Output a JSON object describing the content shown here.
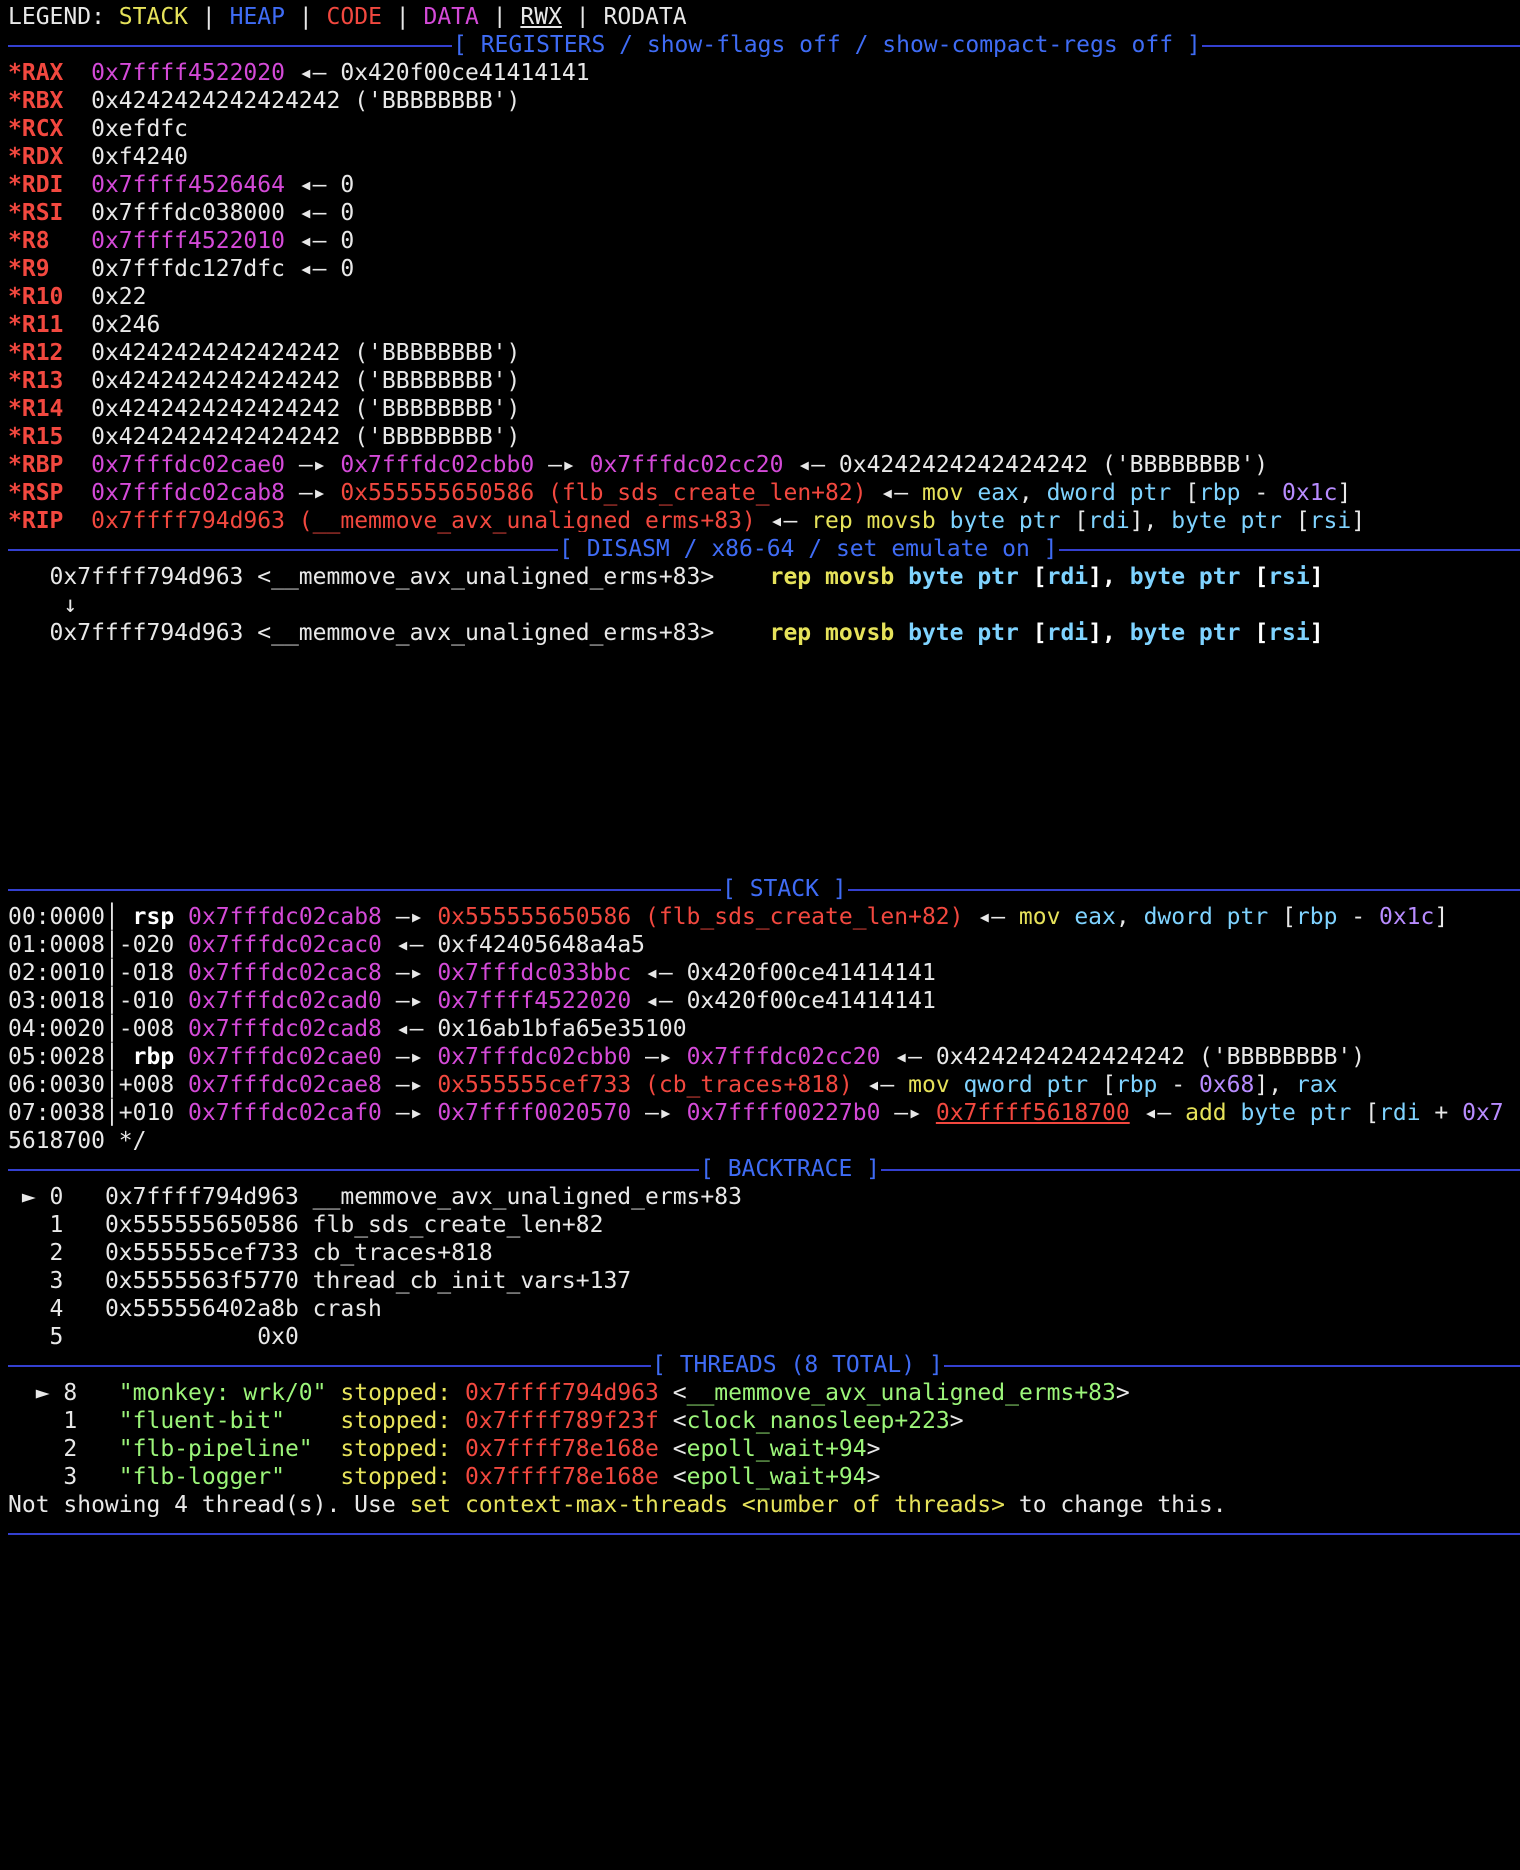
{
  "legend": {
    "label": "LEGEND:",
    "stack": "STACK",
    "heap": "HEAP",
    "code": "CODE",
    "data": "DATA",
    "rwx": "RWX",
    "rodata": "RODATA"
  },
  "headers": {
    "registers": "[ REGISTERS / show-flags off / show-compact-regs off ]",
    "disasm": "[ DISASM / x86-64 / set emulate on ]",
    "stack": "[ STACK ]",
    "backtrace": "[ BACKTRACE ]",
    "threads": "[ THREADS (8 TOTAL) ]"
  },
  "registers": {
    "rax": {
      "name": "*RAX",
      "ptr": "0x7ffff4522020",
      "rest": " ◂— 0x420f00ce41414141"
    },
    "rbx": {
      "name": "*RBX",
      "val": "0x4242424242424242 ('BBBBBBBB')"
    },
    "rcx": {
      "name": "*RCX",
      "val": "0xefdfc"
    },
    "rdx": {
      "name": "*RDX",
      "val": "0xf4240"
    },
    "rdi": {
      "name": "*RDI",
      "ptr": "0x7ffff4526464",
      "rest": " ◂— 0"
    },
    "rsi": {
      "name": "*RSI",
      "ptr": "0x7fffdc038000",
      "rest": " ◂— 0"
    },
    "r8": {
      "name": "*R8",
      "ptr": "0x7ffff4522010",
      "rest": " ◂— 0"
    },
    "r9": {
      "name": "*R9",
      "ptr": "0x7fffdc127dfc",
      "rest": " ◂— 0"
    },
    "r10": {
      "name": "*R10",
      "val": "0x22"
    },
    "r11": {
      "name": "*R11",
      "val": "0x246"
    },
    "r12": {
      "name": "*R12",
      "val": "0x4242424242424242 ('BBBBBBBB')"
    },
    "r13": {
      "name": "*R13",
      "val": "0x4242424242424242 ('BBBBBBBB')"
    },
    "r14": {
      "name": "*R14",
      "val": "0x4242424242424242 ('BBBBBBBB')"
    },
    "r15": {
      "name": "*R15",
      "val": "0x4242424242424242 ('BBBBBBBB')"
    },
    "rbp": {
      "name": "*RBP",
      "p1": "0x7fffdc02cae0",
      "p2": "0x7fffdc02cbb0",
      "p3": "0x7fffdc02cc20",
      "rest": "0x4242424242424242 ('BBBBBBBB')"
    },
    "rsp": {
      "name": "*RSP",
      "p1": "0x7fffdc02cab8",
      "p2": "0x555555650586 (flb_sds_create_len+82)"
    },
    "rip": {
      "name": "*RIP",
      "p1": "0x7ffff794d963 (__memmove_avx_unaligned_erms+83)"
    }
  },
  "disasm": {
    "addr1": "0x7ffff794d963 <__memmove_avx_unaligned_erms+83>",
    "arrow": "↓",
    "addr2": "0x7ffff794d963 <__memmove_avx_unaligned_erms+83>"
  },
  "stack": [
    {
      "idx": "00:0000",
      "off": " rsp",
      "addr": "0x7fffdc02cab8"
    },
    {
      "idx": "01:0008",
      "off": "-020",
      "addr": "0x7fffdc02cac0",
      "rest": "0xf42405648a4a5"
    },
    {
      "idx": "02:0010",
      "off": "-018",
      "addr": "0x7fffdc02cac8",
      "p2": "0x7fffdc033bbc",
      "rest": "0x420f00ce41414141"
    },
    {
      "idx": "03:0018",
      "off": "-010",
      "addr": "0x7fffdc02cad0",
      "p2": "0x7ffff4522020",
      "rest": "0x420f00ce41414141"
    },
    {
      "idx": "04:0020",
      "off": "-008",
      "addr": "0x7fffdc02cad8",
      "rest": "0x16ab1bfa65e35100"
    },
    {
      "idx": "05:0028",
      "off": " rbp",
      "addr": "0x7fffdc02cae0",
      "p2": "0x7fffdc02cbb0",
      "p3": "0x7fffdc02cc20",
      "rest": "0x4242424242424242 ('BBBBBBBB')"
    },
    {
      "idx": "06:0030",
      "off": "+008",
      "addr": "0x7fffdc02cae8",
      "p2": "0x555555cef733 (cb_traces+818)"
    },
    {
      "idx": "07:0038",
      "off": "+010",
      "addr": "0x7fffdc02caf0",
      "p2": "0x7ffff0020570",
      "p3": "0x7ffff00227b0",
      "p4": "0x7ffff5618700"
    }
  ],
  "stack_wrap": "5618700 */",
  "backtrace": [
    {
      "mark": " ► 0",
      "addr": "0x7ffff794d963",
      "sym": "__memmove_avx_unaligned_erms+83"
    },
    {
      "mark": "   1",
      "addr": "0x555555650586",
      "sym": "flb_sds_create_len+82"
    },
    {
      "mark": "   2",
      "addr": "0x555555cef733",
      "sym": "cb_traces+818"
    },
    {
      "mark": "   3",
      "addr": "0x5555563f5770",
      "sym": "thread_cb_init_vars+137"
    },
    {
      "mark": "   4",
      "addr": "0x555556402a8b",
      "sym": "crash"
    },
    {
      "mark": "   5",
      "addr": "           0x0",
      "sym": ""
    }
  ],
  "threads": [
    {
      "mark": "  ► 8",
      "name": "\"monkey: wrk/0\"",
      "addr": "0x7ffff794d963",
      "sym": "__memmove_avx_unaligned_erms+83"
    },
    {
      "mark": "    1",
      "name": "\"fluent-bit\"   ",
      "addr": "0x7ffff789f23f",
      "sym": "clock_nanosleep+223"
    },
    {
      "mark": "    2",
      "name": "\"flb-pipeline\" ",
      "addr": "0x7ffff78e168e",
      "sym": "epoll_wait+94"
    },
    {
      "mark": "    3",
      "name": "\"flb-logger\"   ",
      "addr": "0x7ffff78e168e",
      "sym": "epoll_wait+94"
    }
  ],
  "thread_stopped": "stopped:",
  "footer": {
    "pre": "Not showing 4 thread(s). Use ",
    "cmd": "set context-max-threads <number of threads>",
    "post": " to change this."
  },
  "asm": {
    "arrow": " ◂— ",
    "link": " —▸ ",
    "mov_eax": "mov",
    "eax": "eax",
    "dword_ptr": "dword ptr",
    "rbp": "rbp",
    "minus": " - ",
    "off_1c": "0x1c",
    "rep_movsb": "rep movsb",
    "byte_ptr": "byte ptr",
    "rdi": "rdi",
    "rsi": "rsi",
    "mov_q": "mov",
    "qword_ptr": "qword ptr",
    "off_68": "0x68",
    "rax": "rax",
    "add": "add",
    "rdi_plus": "rdi",
    "plus": " + ",
    "off_7": "0x7"
  }
}
